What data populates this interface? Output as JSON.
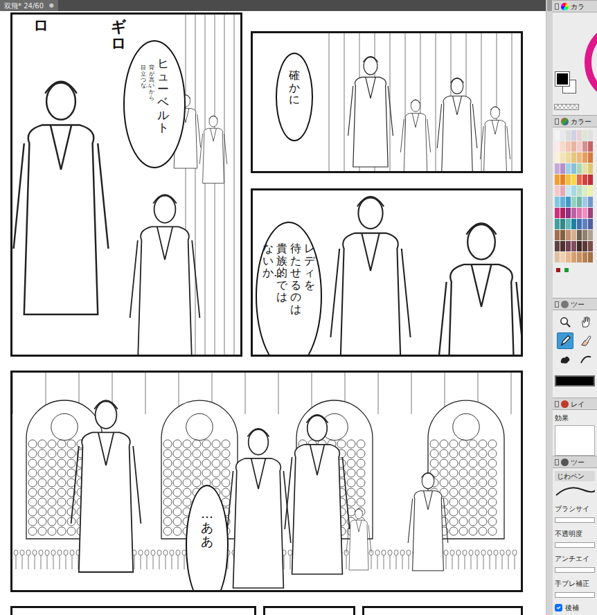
{
  "window": {
    "tab_title": "双飛* 24/60",
    "tab_close": "●"
  },
  "page": {
    "panels": [
      {
        "sfx": [
          "ロ",
          "ギロ"
        ],
        "bubbles": [
          {
            "lines": [
              {
                "text": "ヒューベルト",
                "kind": "speech"
              },
              {
                "text": "背が高いから",
                "kind": "whisper"
              },
              {
                "text": "目立つな…",
                "kind": "whisper"
              }
            ]
          }
        ]
      },
      {
        "sfx": [],
        "bubbles": [
          {
            "lines": [
              {
                "text": "確かに",
                "kind": "speech"
              }
            ]
          }
        ]
      },
      {
        "sfx": [],
        "bubbles": [
          {
            "lines": [
              {
                "text": "レディを",
                "kind": "speech"
              },
              {
                "text": "待たせるのは",
                "kind": "speech"
              },
              {
                "text": "貴族的では",
                "kind": "speech"
              },
              {
                "text": "ないか…",
                "kind": "speech"
              }
            ]
          }
        ]
      },
      {
        "sfx": [],
        "bubbles": [
          {
            "lines": [
              {
                "text": "…ああ",
                "kind": "speech"
              }
            ]
          }
        ]
      },
      {
        "sfx": [],
        "bubbles": []
      },
      {
        "sfx": [],
        "bubbles": []
      },
      {
        "sfx": [],
        "bubbles": []
      }
    ]
  },
  "side_panel": {
    "color_header": "カラ",
    "palette_header": "カラー",
    "palette": [
      "#f4f4f4",
      "#e9e9e9",
      "#dcdcdc",
      "#d0d0e8",
      "#e6d3d3",
      "#dde6d3",
      "#e0e0e0",
      "#fbe8e8",
      "#f9d9c9",
      "#f3c6b0",
      "#e8b4a0",
      "#f6c8c8",
      "#d88f8f",
      "#c86464",
      "#fdf0d8",
      "#f5e3b5",
      "#eed9a0",
      "#e6c67a",
      "#f0b77c",
      "#e89d5c",
      "#d87a3c",
      "#c8a8d8",
      "#b48fc8",
      "#9ed0e6",
      "#88c0d8",
      "#a8d8b8",
      "#e8e0a0",
      "#e0c870",
      "#f0a030",
      "#e88020",
      "#f0c040",
      "#f8d848",
      "#e06848",
      "#d84040",
      "#c03030",
      "#f8c8c8",
      "#e8a8b8",
      "#c8e8f0",
      "#a8d8e8",
      "#b8e0c8",
      "#d8f0c0",
      "#f0f0a8",
      "#80c8e0",
      "#60b0d8",
      "#4098c8",
      "#98d0c0",
      "#70b8a8",
      "#a0c8e8",
      "#7098c8",
      "#d03080",
      "#b02060",
      "#903080",
      "#c060a0",
      "#e070b0",
      "#f090c0",
      "#a04080",
      "#40a0a0",
      "#308888",
      "#60b8b8",
      "#2080a0",
      "#4070b0",
      "#6080c0",
      "#5060a0",
      "#a07050",
      "#886040",
      "#c09070",
      "#d8b090",
      "#706050",
      "#908070",
      "#b0a090",
      "#604040",
      "#503030",
      "#704050",
      "#805060",
      "#402828",
      "#603838",
      "#785048",
      "#e0c0a0",
      "#f0d0b0",
      "#e8b890",
      "#d8a070",
      "#c89060",
      "#b88050",
      "#a87040"
    ],
    "tool_header": "ツー",
    "tools": [
      {
        "kind": "zoom",
        "selected": false
      },
      {
        "kind": "hand",
        "selected": false
      },
      {
        "kind": "pen",
        "selected": true
      },
      {
        "kind": "eraser",
        "selected": false
      },
      {
        "kind": "blob",
        "selected": false
      },
      {
        "kind": "curve",
        "selected": false
      }
    ],
    "current_color": "#000000",
    "layer_header": "レイ",
    "effect_label": "効果",
    "property_header": "ツー",
    "brush_name": "じわペン",
    "properties": [
      "ブラシサイ",
      "不透明度",
      "アンチエイ",
      "手ブレ補正"
    ],
    "post_correction": {
      "label": "後補",
      "checked": true
    }
  }
}
